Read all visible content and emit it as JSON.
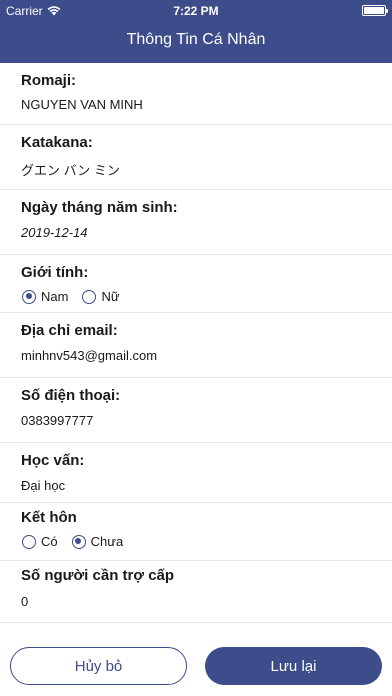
{
  "status_bar": {
    "carrier": "Carrier",
    "time": "7:22 PM"
  },
  "header": {
    "title": "Thông Tin Cá Nhân"
  },
  "form": {
    "romaji": {
      "label": "Romaji:",
      "value": "NGUYEN VAN MINH"
    },
    "katakana": {
      "label": "Katakana:",
      "value": "グエン バン ミン"
    },
    "birthdate": {
      "label": "Ngày tháng năm sinh:",
      "value": "2019-12-14"
    },
    "gender": {
      "label": "Giới tính:",
      "options": [
        "Nam",
        "Nữ"
      ],
      "selected": "Nam"
    },
    "email": {
      "label": "Địa chỉ email:",
      "value": "minhnv543@gmail.com"
    },
    "phone": {
      "label": "Số điện thoại:",
      "value": "0383997777"
    },
    "education": {
      "label": "Học vấn:",
      "value": "Đại học"
    },
    "marital": {
      "label": "Kết hôn",
      "options": [
        "Có",
        "Chưa"
      ],
      "selected": "Chưa"
    },
    "dependents": {
      "label": "Số người cần trợ cấp",
      "value": "0"
    }
  },
  "footer": {
    "cancel_label": "Hủy bỏ",
    "save_label": "Lưu lại"
  },
  "colors": {
    "primary": "#3d4c8a",
    "divider": "#e6e6e6"
  }
}
